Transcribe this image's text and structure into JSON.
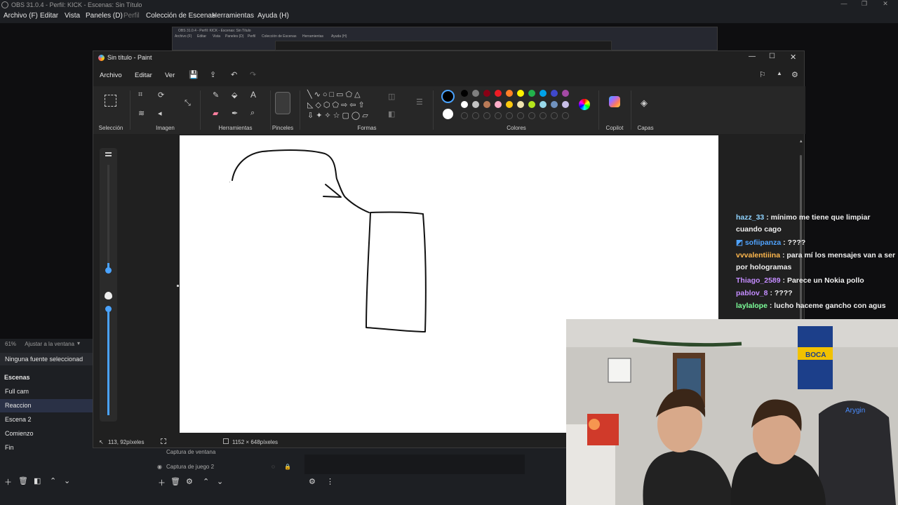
{
  "obs": {
    "title": "OBS 31.0.4 - Perfil: KICK - Escenas: Sin Título",
    "menu": [
      "Archivo (F)",
      "Editar",
      "Vista",
      "Paneles (D)",
      "Perfil",
      "Colección de Escenas",
      "Herramientas",
      "Ayuda (H)"
    ],
    "nested_title": "OBS 31.0.4 - Perfil: KICK - Escenas: Sin Título",
    "nested_menu": [
      "Archivo (F)",
      "Editar",
      "Vista",
      "Paneles (D)",
      "Perfil",
      "Colección de Escenas",
      "Herramientas",
      "Ayuda (H)"
    ],
    "zoom_percent": "61%",
    "zoom_fit": "Ajustar a la ventana",
    "no_source": "Ninguna fuente seleccionad",
    "scenes_header": "Escenas",
    "scenes": [
      "Full cam",
      "Reaccion",
      "Escena 2",
      "Comienzo",
      "Fin"
    ],
    "active_scene_index": 1,
    "sources": [
      "Captura de ventana",
      "Captura de juego 2"
    ]
  },
  "paint": {
    "title": "Sin título - Paint",
    "menu": [
      "Archivo",
      "Editar",
      "Ver"
    ],
    "groups": {
      "seleccion": "Selección",
      "imagen": "Imagen",
      "herramientas": "Herramientas",
      "pinceles": "Pinceles",
      "formas": "Formas",
      "colores": "Colores",
      "copilot": "Copilot",
      "capas": "Capas"
    },
    "palette_row1": [
      "#000000",
      "#7f7f7f",
      "#880015",
      "#ed1c24",
      "#ff7f27",
      "#fff200",
      "#22b14c",
      "#00a2e8",
      "#3f48cc",
      "#a349a4"
    ],
    "palette_row2": [
      "#ffffff",
      "#c3c3c3",
      "#b97a57",
      "#ffaec9",
      "#ffc90e",
      "#efe4b0",
      "#b5e61d",
      "#99d9ea",
      "#7092be",
      "#c8bfe7"
    ],
    "primary_color": "#000000",
    "secondary_color": "#ffffff",
    "cursor_pos": "113, 92píxeles",
    "canvas_size": "1152 × 648píxeles"
  },
  "chat": {
    "messages": [
      {
        "user": "hazz_33",
        "color": "#8fd3ff",
        "text": "mínimo me tiene que limpiar cuando cago"
      },
      {
        "user": "sofiipanza",
        "color": "#4fa3ff",
        "text": "????",
        "badge": true
      },
      {
        "user": "vvvalentiiina",
        "color": "#ffb84d",
        "text": "para mí los mensajes van a ser por hologramas"
      },
      {
        "user": "Thiago_2589",
        "color": "#c48cff",
        "text": "Parece un Nokia pollo"
      },
      {
        "user": "pablov_8",
        "color": "#c48cff",
        "text": "????"
      },
      {
        "user": "laylalope",
        "color": "#7dff9a",
        "text": "lucho haceme gancho con agus"
      }
    ]
  },
  "camera": {
    "banner_text": "BOCA",
    "chair_brand": "Arygin"
  }
}
